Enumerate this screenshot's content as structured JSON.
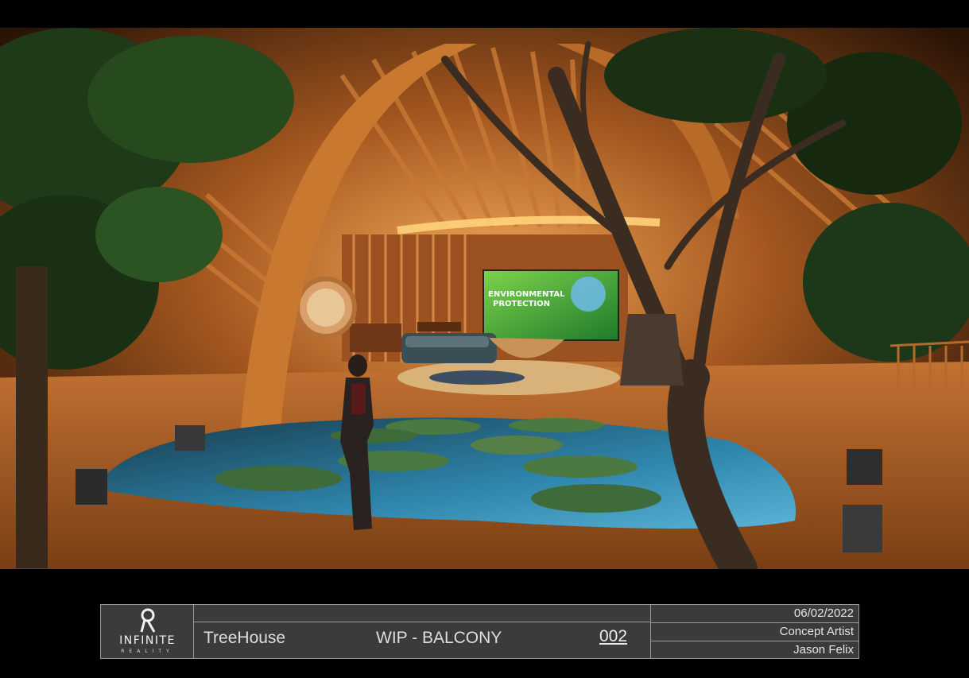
{
  "scene": {
    "screen_text": [
      "ENVIRONMENTAL",
      "PROTECTION"
    ],
    "colors": {
      "wood": "#b4652a",
      "wood_light": "#e0a05a",
      "water": "#3c8fb0",
      "foliage": "#1f3a18",
      "screen": "#3aa53a"
    }
  },
  "titleblock": {
    "logo": {
      "icon": "infinite-reality-logo-icon",
      "word": "INFINITE",
      "sub": "REALITY"
    },
    "project": "TreeHouse",
    "stage": "WIP - BALCONY",
    "sheet": "002",
    "date": "06/02/2022",
    "role": "Concept Artist",
    "artist": "Jason Felix"
  }
}
